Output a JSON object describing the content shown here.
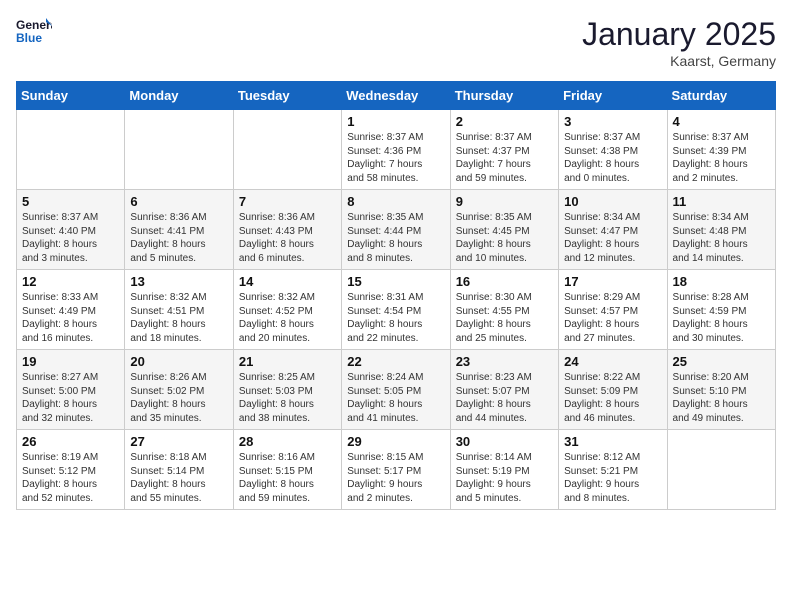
{
  "logo": {
    "line1": "General",
    "line2": "Blue"
  },
  "title": "January 2025",
  "subtitle": "Kaarst, Germany",
  "days_of_week": [
    "Sunday",
    "Monday",
    "Tuesday",
    "Wednesday",
    "Thursday",
    "Friday",
    "Saturday"
  ],
  "weeks": [
    [
      {
        "num": "",
        "text": ""
      },
      {
        "num": "",
        "text": ""
      },
      {
        "num": "",
        "text": ""
      },
      {
        "num": "1",
        "text": "Sunrise: 8:37 AM\nSunset: 4:36 PM\nDaylight: 7 hours\nand 58 minutes."
      },
      {
        "num": "2",
        "text": "Sunrise: 8:37 AM\nSunset: 4:37 PM\nDaylight: 7 hours\nand 59 minutes."
      },
      {
        "num": "3",
        "text": "Sunrise: 8:37 AM\nSunset: 4:38 PM\nDaylight: 8 hours\nand 0 minutes."
      },
      {
        "num": "4",
        "text": "Sunrise: 8:37 AM\nSunset: 4:39 PM\nDaylight: 8 hours\nand 2 minutes."
      }
    ],
    [
      {
        "num": "5",
        "text": "Sunrise: 8:37 AM\nSunset: 4:40 PM\nDaylight: 8 hours\nand 3 minutes."
      },
      {
        "num": "6",
        "text": "Sunrise: 8:36 AM\nSunset: 4:41 PM\nDaylight: 8 hours\nand 5 minutes."
      },
      {
        "num": "7",
        "text": "Sunrise: 8:36 AM\nSunset: 4:43 PM\nDaylight: 8 hours\nand 6 minutes."
      },
      {
        "num": "8",
        "text": "Sunrise: 8:35 AM\nSunset: 4:44 PM\nDaylight: 8 hours\nand 8 minutes."
      },
      {
        "num": "9",
        "text": "Sunrise: 8:35 AM\nSunset: 4:45 PM\nDaylight: 8 hours\nand 10 minutes."
      },
      {
        "num": "10",
        "text": "Sunrise: 8:34 AM\nSunset: 4:47 PM\nDaylight: 8 hours\nand 12 minutes."
      },
      {
        "num": "11",
        "text": "Sunrise: 8:34 AM\nSunset: 4:48 PM\nDaylight: 8 hours\nand 14 minutes."
      }
    ],
    [
      {
        "num": "12",
        "text": "Sunrise: 8:33 AM\nSunset: 4:49 PM\nDaylight: 8 hours\nand 16 minutes."
      },
      {
        "num": "13",
        "text": "Sunrise: 8:32 AM\nSunset: 4:51 PM\nDaylight: 8 hours\nand 18 minutes."
      },
      {
        "num": "14",
        "text": "Sunrise: 8:32 AM\nSunset: 4:52 PM\nDaylight: 8 hours\nand 20 minutes."
      },
      {
        "num": "15",
        "text": "Sunrise: 8:31 AM\nSunset: 4:54 PM\nDaylight: 8 hours\nand 22 minutes."
      },
      {
        "num": "16",
        "text": "Sunrise: 8:30 AM\nSunset: 4:55 PM\nDaylight: 8 hours\nand 25 minutes."
      },
      {
        "num": "17",
        "text": "Sunrise: 8:29 AM\nSunset: 4:57 PM\nDaylight: 8 hours\nand 27 minutes."
      },
      {
        "num": "18",
        "text": "Sunrise: 8:28 AM\nSunset: 4:59 PM\nDaylight: 8 hours\nand 30 minutes."
      }
    ],
    [
      {
        "num": "19",
        "text": "Sunrise: 8:27 AM\nSunset: 5:00 PM\nDaylight: 8 hours\nand 32 minutes."
      },
      {
        "num": "20",
        "text": "Sunrise: 8:26 AM\nSunset: 5:02 PM\nDaylight: 8 hours\nand 35 minutes."
      },
      {
        "num": "21",
        "text": "Sunrise: 8:25 AM\nSunset: 5:03 PM\nDaylight: 8 hours\nand 38 minutes."
      },
      {
        "num": "22",
        "text": "Sunrise: 8:24 AM\nSunset: 5:05 PM\nDaylight: 8 hours\nand 41 minutes."
      },
      {
        "num": "23",
        "text": "Sunrise: 8:23 AM\nSunset: 5:07 PM\nDaylight: 8 hours\nand 44 minutes."
      },
      {
        "num": "24",
        "text": "Sunrise: 8:22 AM\nSunset: 5:09 PM\nDaylight: 8 hours\nand 46 minutes."
      },
      {
        "num": "25",
        "text": "Sunrise: 8:20 AM\nSunset: 5:10 PM\nDaylight: 8 hours\nand 49 minutes."
      }
    ],
    [
      {
        "num": "26",
        "text": "Sunrise: 8:19 AM\nSunset: 5:12 PM\nDaylight: 8 hours\nand 52 minutes."
      },
      {
        "num": "27",
        "text": "Sunrise: 8:18 AM\nSunset: 5:14 PM\nDaylight: 8 hours\nand 55 minutes."
      },
      {
        "num": "28",
        "text": "Sunrise: 8:16 AM\nSunset: 5:15 PM\nDaylight: 8 hours\nand 59 minutes."
      },
      {
        "num": "29",
        "text": "Sunrise: 8:15 AM\nSunset: 5:17 PM\nDaylight: 9 hours\nand 2 minutes."
      },
      {
        "num": "30",
        "text": "Sunrise: 8:14 AM\nSunset: 5:19 PM\nDaylight: 9 hours\nand 5 minutes."
      },
      {
        "num": "31",
        "text": "Sunrise: 8:12 AM\nSunset: 5:21 PM\nDaylight: 9 hours\nand 8 minutes."
      },
      {
        "num": "",
        "text": ""
      }
    ]
  ]
}
